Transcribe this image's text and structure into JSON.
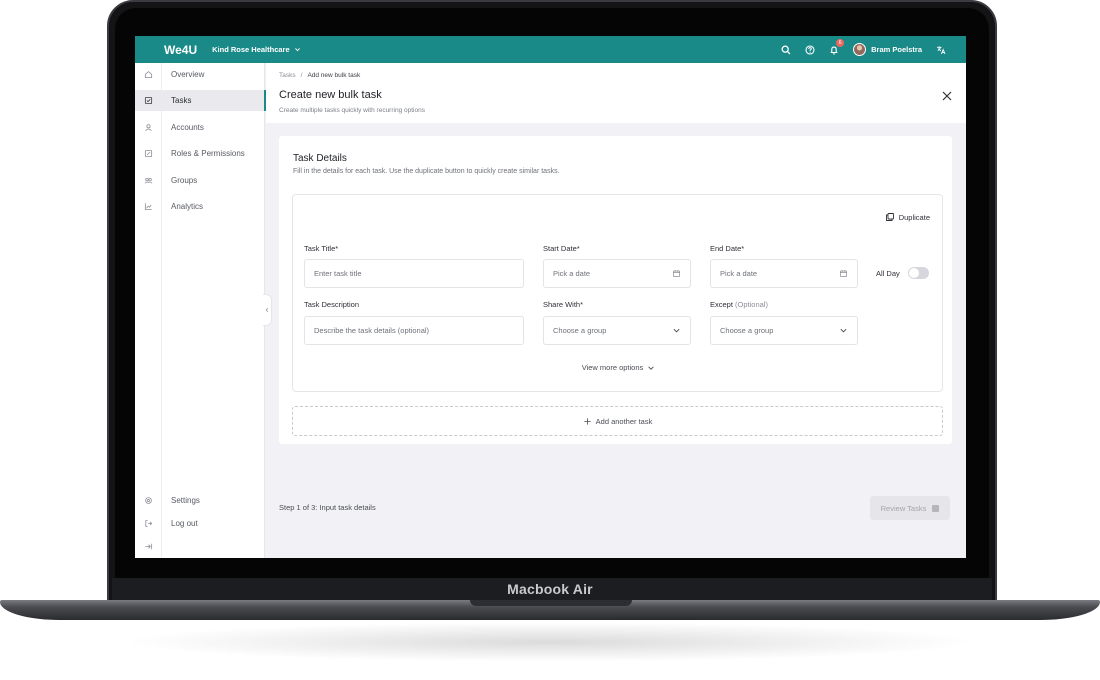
{
  "device": {
    "model_label": "Macbook Air"
  },
  "topbar": {
    "brand": "We4U",
    "organization": "Kind Rose Healthcare",
    "notification_count": "6",
    "user_name": "Bram Poelstra",
    "icons": [
      "search-icon",
      "help-icon",
      "bell-icon",
      "translate-icon"
    ]
  },
  "sidebar": {
    "items": [
      {
        "label": "Overview",
        "icon": "home-icon"
      },
      {
        "label": "Tasks",
        "icon": "checkbox-icon",
        "active": true
      },
      {
        "label": "Accounts",
        "icon": "user-icon"
      },
      {
        "label": "Roles & Permissions",
        "icon": "edit-icon"
      },
      {
        "label": "Groups",
        "icon": "group-icon"
      },
      {
        "label": "Analytics",
        "icon": "chart-icon"
      }
    ],
    "bottom_items": [
      {
        "label": "Settings",
        "icon": "gear-icon"
      },
      {
        "label": "Log out",
        "icon": "logout-icon"
      }
    ]
  },
  "page": {
    "breadcrumb": [
      "Tasks",
      "Add new bulk task"
    ],
    "breadcrumb_separator": "/",
    "title": "Create new bulk task",
    "subtitle": "Create multiple tasks quickly with recurring options"
  },
  "card": {
    "title": "Task Details",
    "subtitle": "Fill in the details for each task. Use the duplicate button to quickly create similar tasks."
  },
  "task": {
    "duplicate_label": "Duplicate",
    "title_label": "Task Title*",
    "title_placeholder": "Enter task title",
    "start_label": "Start Date*",
    "start_placeholder": "Pick a date",
    "end_label": "End Date*",
    "end_placeholder": "Pick a date",
    "allday_label": "All Day",
    "allday_on": false,
    "desc_label": "Task Description",
    "desc_placeholder": "Describe the task details (optional)",
    "share_label": "Share With*",
    "share_placeholder": "Choose a group",
    "except_label": "Except",
    "except_optional": "(Optional)",
    "except_placeholder": "Choose a group",
    "more_options": "View more options"
  },
  "add_task_label": "Add another task",
  "footer": {
    "step_text": "Step 1 of 3: Input task details",
    "review_label": "Review Tasks"
  },
  "colors": {
    "brand": "#1a8a88",
    "badge": "#e9695f",
    "background": "#f2f2f6"
  }
}
